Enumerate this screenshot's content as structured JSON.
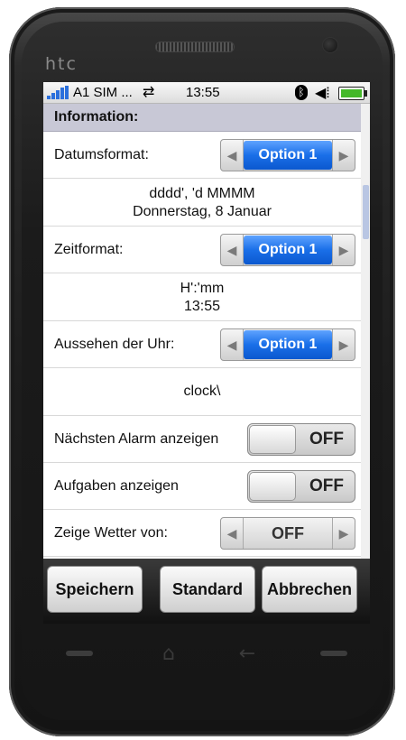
{
  "device": {
    "brand": "htc"
  },
  "statusbar": {
    "carrier": "A1 SIM ...",
    "time": "13:55",
    "arrows_glyph": "⇄",
    "bluetooth_glyph": "ᛒ",
    "volume_glyph": "◀︎⁞"
  },
  "section": {
    "title": "Information:"
  },
  "rows": {
    "date_format": {
      "label": "Datumsformat:",
      "value": "Option 1"
    },
    "date_preview": {
      "line1": "dddd', 'd MMMM",
      "line2": "Donnerstag, 8 Januar"
    },
    "time_format": {
      "label": "Zeitformat:",
      "value": "Option 1"
    },
    "time_preview": {
      "line1": "H':'mm",
      "line2": "13:55"
    },
    "clock_look": {
      "label": "Aussehen der Uhr:",
      "value": "Option 1"
    },
    "clock_preview": {
      "text": "clock\\"
    },
    "next_alarm": {
      "label": "Nächsten Alarm anzeigen",
      "state": "OFF"
    },
    "tasks": {
      "label": "Aufgaben anzeigen",
      "state": "OFF"
    },
    "weather": {
      "label": "Zeige Wetter von:",
      "value": "OFF"
    }
  },
  "buttons": {
    "save": "Speichern",
    "default": "Standard",
    "cancel": "Abbrechen"
  },
  "icons": {
    "left": "◀",
    "right": "▶",
    "home": "⌂",
    "back": "←"
  },
  "colors": {
    "accent_blue": "#1a6fe8",
    "battery_green": "#44b829",
    "header_bg": "#c8c8d6"
  }
}
